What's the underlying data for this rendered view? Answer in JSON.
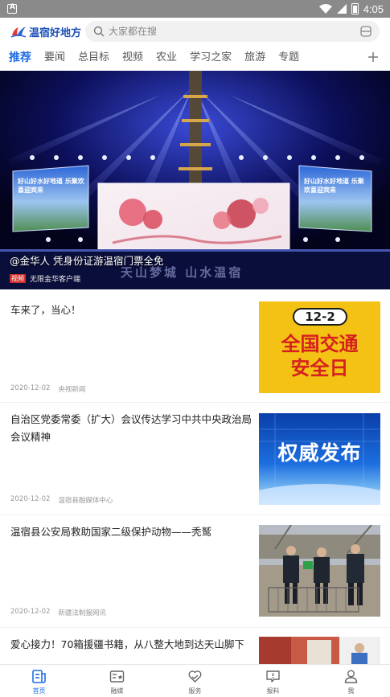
{
  "status_bar": {
    "time": "4:05"
  },
  "header": {
    "logo_text": "温宿好地方",
    "search_placeholder": "大家都在搜"
  },
  "tabs": [
    {
      "label": "推荐",
      "active": true
    },
    {
      "label": "要闻"
    },
    {
      "label": "总目标"
    },
    {
      "label": "视频"
    },
    {
      "label": "农业"
    },
    {
      "label": "学习之家"
    },
    {
      "label": "旅游"
    },
    {
      "label": "专题"
    }
  ],
  "hero": {
    "title": "@金华人 凭身份证游温宿门票全免",
    "tag": "视频",
    "source": "无限金华客户端",
    "stage_caption": "天山梦城 山水温宿",
    "screen_left_text": "好山好水好地道 乐聚欢喜迎宾来",
    "screen_right_text": "好山好水好地道 乐聚欢喜迎宾来"
  },
  "news": [
    {
      "title": "车来了，当心！",
      "date": "2020-12-02",
      "source": "央视新闻",
      "thumb": {
        "line1": "12-2",
        "line2": "全国交通",
        "line3": "安全日"
      }
    },
    {
      "title": "自治区党委常委（扩大）会议传达学习中共中央政治局会议精神",
      "date": "2020-12-02",
      "source": "温宿县融媒体中心",
      "thumb": {
        "line1": "权威发布"
      }
    },
    {
      "title": "温宿县公安局救助国家二级保护动物——秃鹫",
      "date": "2020-12-02",
      "source": "新疆法制报网讯"
    },
    {
      "title": "爱心接力！70箱援疆书籍，从八整大地到达天山脚下"
    }
  ],
  "bottom_nav": [
    {
      "label": "首页",
      "icon": "home-doc-icon",
      "active": true
    },
    {
      "label": "融媒",
      "icon": "media-star-icon"
    },
    {
      "label": "服务",
      "icon": "heart-service-icon"
    },
    {
      "label": "报料",
      "icon": "report-chat-icon"
    },
    {
      "label": "我",
      "icon": "user-icon"
    }
  ],
  "colors": {
    "accent": "#1e6ee6",
    "status_bar": "#8a8a8a",
    "tag_red": "#d0312d"
  }
}
